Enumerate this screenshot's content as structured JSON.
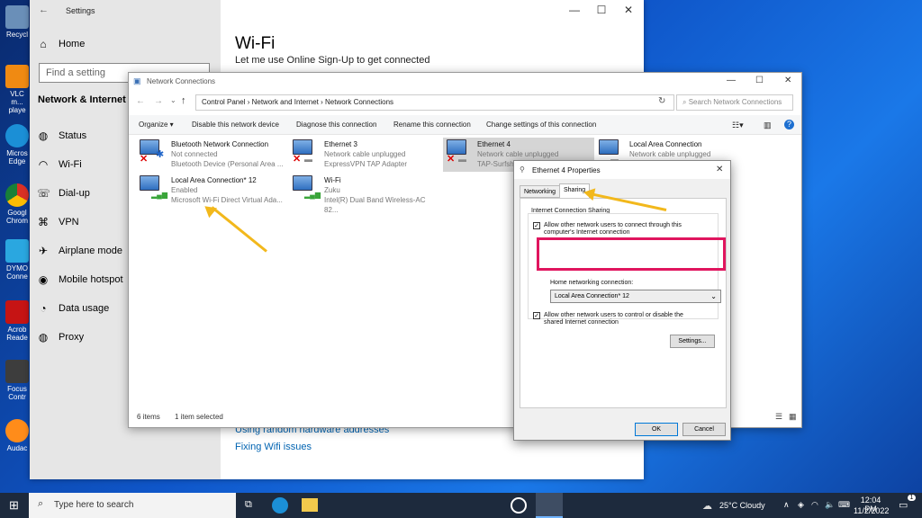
{
  "desktop": {
    "icons": [
      {
        "label": "Recycl",
        "color": "#6a8fb8"
      },
      {
        "label": "VLC m... playe",
        "color": "#f08a12"
      },
      {
        "label": "Micros Edge",
        "color": "#1b8fd6"
      },
      {
        "label": "Googl Chrom",
        "color": "#e8e8e8"
      },
      {
        "label": "DYMO Conne",
        "color": "#2aa7e0"
      },
      {
        "label": "Acrob Reade",
        "color": "#c61414"
      },
      {
        "label": "Focus Contr",
        "color": "#3d3d3d"
      },
      {
        "label": "Audac",
        "color": "#ff8c1a"
      }
    ]
  },
  "settings": {
    "title": "Settings",
    "home": "Home",
    "search_placeholder": "Find a setting",
    "category": "Network & Internet",
    "nav": [
      {
        "label": "Status",
        "icon": "globe-icon"
      },
      {
        "label": "Wi-Fi",
        "icon": "wifi-icon"
      },
      {
        "label": "Dial-up",
        "icon": "phone-icon"
      },
      {
        "label": "VPN",
        "icon": "vpn-icon"
      },
      {
        "label": "Airplane mode",
        "icon": "airplane-icon"
      },
      {
        "label": "Mobile hotspot",
        "icon": "hotspot-icon"
      },
      {
        "label": "Data usage",
        "icon": "data-usage-icon"
      },
      {
        "label": "Proxy",
        "icon": "globe-icon"
      }
    ],
    "page_title": "Wi-Fi",
    "online_signup": "Let me use Online Sign-Up to get connected",
    "link_random": "Using random hardware addresses",
    "link_fix": "Fixing Wifi issues"
  },
  "netconn": {
    "title": "Network Connections",
    "breadcrumb": [
      "Control Panel",
      "Network and Internet",
      "Network Connections"
    ],
    "search_placeholder": "Search Network Connections",
    "toolbar": [
      "Organize ▾",
      "Disable this network device",
      "Diagnose this connection",
      "Rename this connection",
      "Change settings of this connection"
    ],
    "connections": [
      {
        "name": "Bluetooth Network Connection",
        "status": "Not connected",
        "device": "Bluetooth Device (Personal Area ..."
      },
      {
        "name": "Ethernet 3",
        "status": "Network cable unplugged",
        "device": "ExpressVPN TAP Adapter"
      },
      {
        "name": "Ethernet 4",
        "status": "Network cable unplugged",
        "device": "TAP-Surfsha"
      },
      {
        "name": "Local Area Connection",
        "status": "Network cable unplugged",
        "device": ""
      },
      {
        "name": "Local Area Connection* 12",
        "status": "Enabled",
        "device": "Microsoft Wi-Fi Direct Virtual Ada..."
      },
      {
        "name": "Wi-Fi",
        "status": "Zuku",
        "device": "Intel(R) Dual Band Wireless-AC 82..."
      }
    ],
    "status_items": "6 items",
    "status_selected": "1 item selected"
  },
  "props": {
    "title": "Ethernet 4 Properties",
    "tabs": [
      "Networking",
      "Sharing"
    ],
    "group_label": "Internet Connection Sharing",
    "allow_connect": "Allow other network users to connect through this computer's Internet connection",
    "home_label": "Home networking connection:",
    "home_value": "Local Area Connection* 12",
    "allow_control": "Allow other network users to control or disable the shared Internet connection",
    "settings_btn": "Settings...",
    "ok": "OK",
    "cancel": "Cancel"
  },
  "taskbar": {
    "search_placeholder": "Type here to search",
    "weather": "25°C Cloudy",
    "time": "12:04 PM",
    "date": "11/2/2022",
    "notifications": "1"
  },
  "colors": {
    "accent": "#0078d7",
    "highlight": "#e0155e",
    "arrow": "#f2b81c"
  }
}
